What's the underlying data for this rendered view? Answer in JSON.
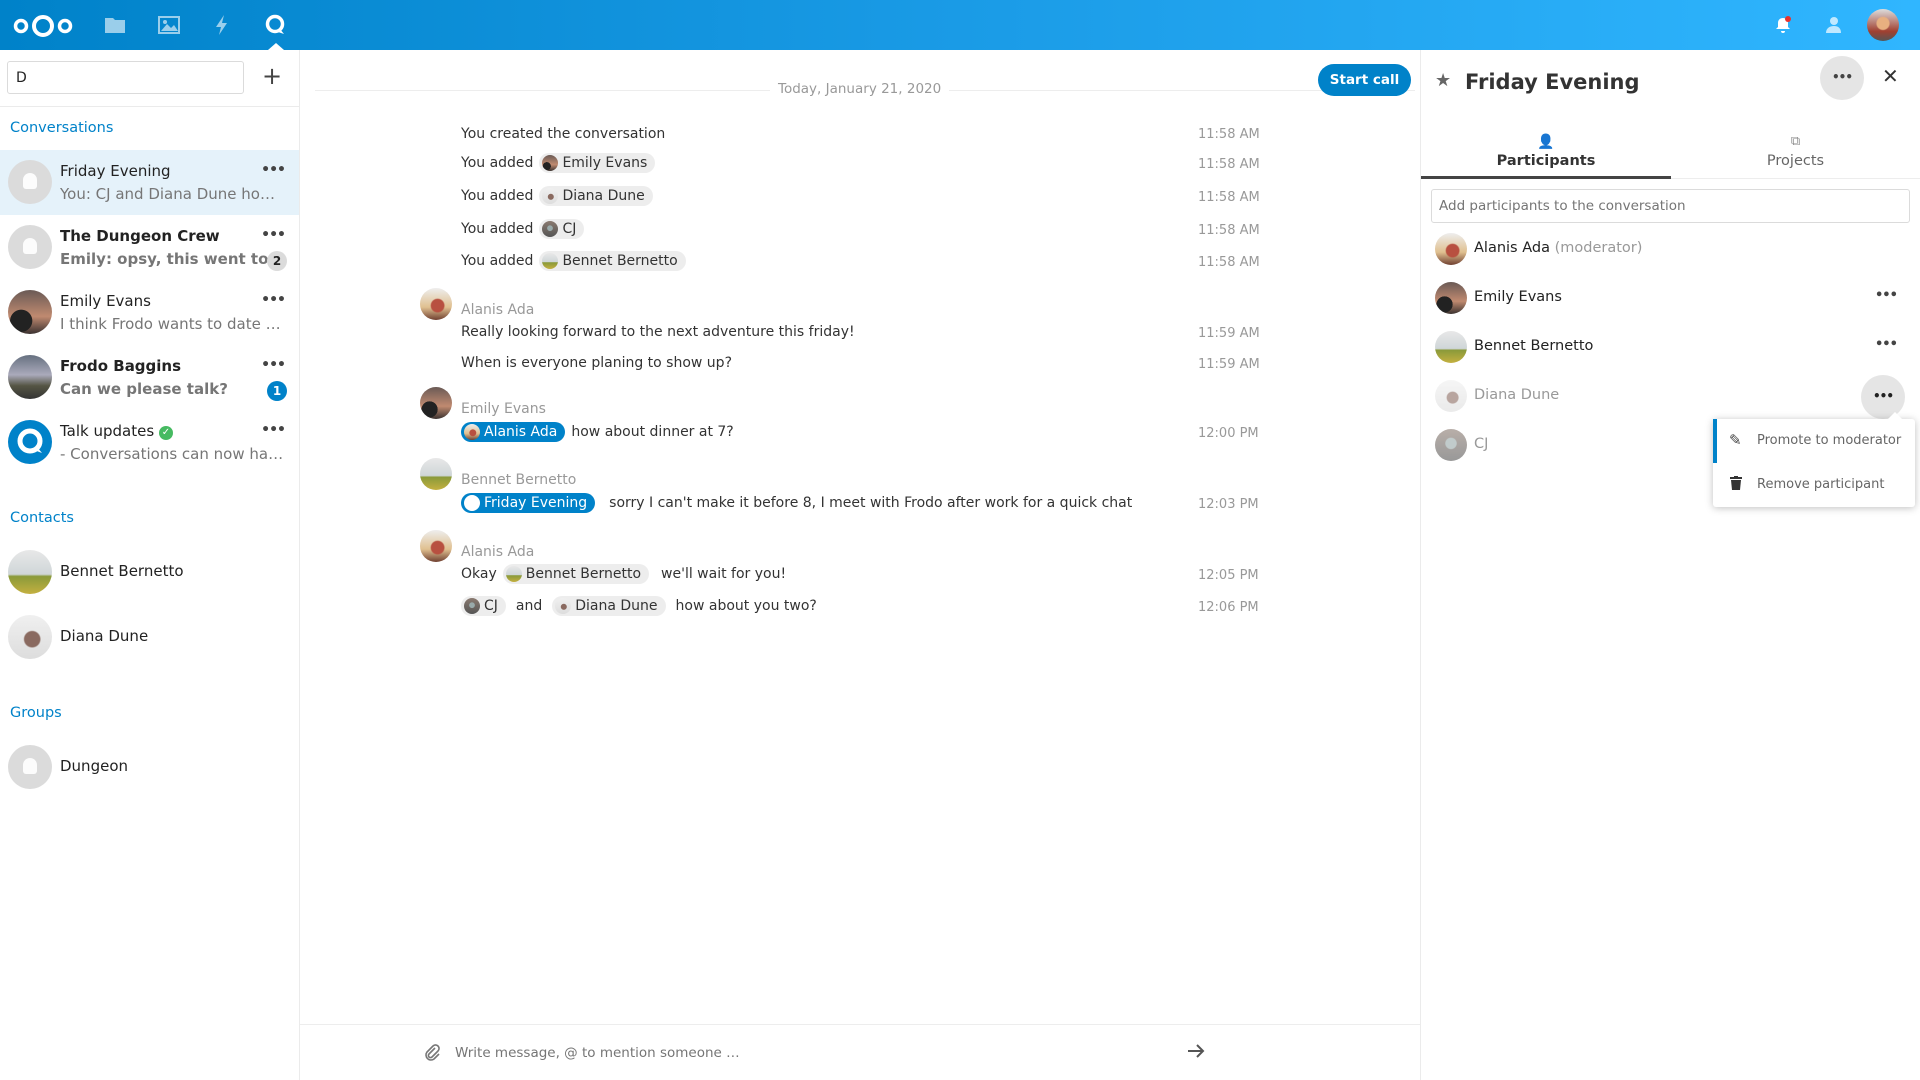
{
  "header": {
    "apps": [
      {
        "icon": "files-icon"
      },
      {
        "icon": "photos-icon"
      },
      {
        "icon": "activity-icon"
      },
      {
        "icon": "talk-icon",
        "active": true
      }
    ],
    "right": [
      {
        "icon": "notifications-icon"
      },
      {
        "icon": "contacts-icon"
      },
      {
        "icon": "user-avatar"
      }
    ],
    "brand_color": "#0082c9"
  },
  "sidebar": {
    "search_value": "D",
    "add_label": "+",
    "conversations_label": "Conversations",
    "conversations": [
      {
        "name": "Friday Evening",
        "last": "You: CJ and Diana Dune how about you two?",
        "active": true,
        "bold": false
      },
      {
        "name": "The Dungeon Crew",
        "last": "Emily: opsy, this went to the wrong chat",
        "bold": true,
        "unread": "2"
      },
      {
        "name": "Emily Evans",
        "last": "I think Frodo wants to date me",
        "bold": false
      },
      {
        "name": "Frodo Baggins",
        "last": "Can we please talk?",
        "bold": true,
        "unread": "1",
        "mention": true
      },
      {
        "name": "Talk updates",
        "last": "- Conversations can now have a description",
        "bold": false,
        "verified": true
      }
    ],
    "contacts_label": "Contacts",
    "contacts": [
      {
        "name": "Bennet Bernetto"
      },
      {
        "name": "Diana Dune"
      }
    ],
    "groups_label": "Groups",
    "groups": [
      {
        "name": "Dungeon"
      }
    ]
  },
  "chat": {
    "date": "Today, January 21, 2020",
    "start_call": "Start call",
    "system": [
      {
        "text": "You created the conversation",
        "time": "11:58 AM"
      },
      {
        "text": "You added",
        "mention": "Emily Evans",
        "time": "11:58 AM"
      },
      {
        "text": "You added",
        "mention": "Diana Dune",
        "time": "11:58 AM"
      },
      {
        "text": "You added",
        "mention": "CJ",
        "time": "11:58 AM"
      },
      {
        "text": "You added",
        "mention": "Bennet Bernetto",
        "time": "11:58 AM"
      }
    ],
    "groups": [
      {
        "author": "Alanis Ada",
        "messages": [
          {
            "text": "Really looking forward to the next adventure this friday!",
            "time": "11:59 AM"
          },
          {
            "text": "When is everyone planing to show up?",
            "time": "11:59 AM"
          }
        ]
      },
      {
        "author": "Emily Evans",
        "messages": [
          {
            "mention": "Alanis Ada",
            "text": "how about dinner at 7?",
            "time": "12:00 PM"
          }
        ]
      },
      {
        "author": "Bennet Bernetto",
        "messages": [
          {
            "mention": "Friday Evening",
            "text": "sorry I can't make it before 8, I meet with Frodo after work for a quick chat",
            "time": "12:03 PM"
          }
        ]
      },
      {
        "author": "Alanis Ada",
        "messages": [
          {
            "pre": "Okay",
            "mention": "Bennet Bernetto",
            "text": "we'll wait for you!",
            "time": "12:05 PM"
          },
          {
            "mention": "CJ",
            "mid": "and",
            "mention2": "Diana Dune",
            "text": "how about you two?",
            "time": "12:06 PM"
          }
        ]
      }
    ],
    "composer_placeholder": "Write message, @ to mention someone …"
  },
  "right": {
    "title": "Friday Evening",
    "tabs": [
      {
        "label": "Participants",
        "active": true
      },
      {
        "label": "Projects"
      }
    ],
    "add_placeholder": "Add participants to the conversation",
    "participants": [
      {
        "name": "Alanis Ada",
        "role": "(moderator)"
      },
      {
        "name": "Emily Evans"
      },
      {
        "name": "Bennet Bernetto"
      },
      {
        "name": "Diana Dune",
        "offline": true
      },
      {
        "name": "CJ",
        "offline": true
      }
    ],
    "menu": [
      {
        "label": "Promote to moderator",
        "icon": "pencil-icon"
      },
      {
        "label": "Remove participant",
        "icon": "trash-icon"
      }
    ]
  }
}
